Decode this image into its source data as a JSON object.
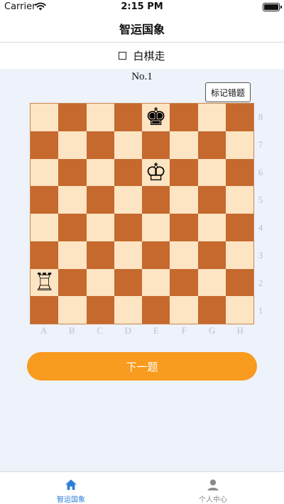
{
  "status_bar": {
    "carrier": "Carrier",
    "time": "2:15 PM"
  },
  "nav": {
    "title": "智运国象"
  },
  "turn": {
    "label": "白棋走"
  },
  "problem": {
    "number": "No.1"
  },
  "mark_button": {
    "label": "标记错题"
  },
  "board": {
    "files": [
      "A",
      "B",
      "C",
      "D",
      "E",
      "F",
      "G",
      "H"
    ],
    "ranks": [
      "8",
      "7",
      "6",
      "5",
      "4",
      "3",
      "2",
      "1"
    ],
    "pieces": [
      {
        "square": "E8",
        "piece": "black-king",
        "glyph": "♚"
      },
      {
        "square": "E6",
        "piece": "white-king",
        "glyph": "♔"
      },
      {
        "square": "A2",
        "piece": "white-rook",
        "glyph": "♖"
      }
    ],
    "colors": {
      "light": "#fde4c2",
      "dark": "#c5692f"
    }
  },
  "next_button": {
    "label": "下一题"
  },
  "tabs": [
    {
      "label": "智运国象",
      "icon": "home-icon",
      "active": true
    },
    {
      "label": "个人中心",
      "icon": "person-icon",
      "active": false
    }
  ],
  "colors": {
    "accent": "#f99b1e",
    "tab_active": "#2f7fd8",
    "tab_inactive": "#8a8a8a"
  }
}
